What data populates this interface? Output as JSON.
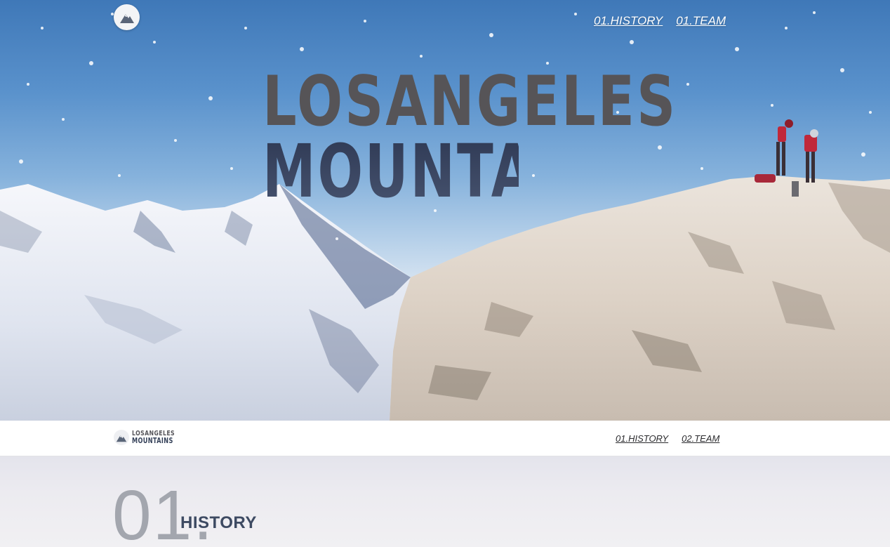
{
  "hero": {
    "logo_icon": "mountain-icon",
    "nav": [
      {
        "label": "01.HISTORY"
      },
      {
        "label": "01.TEAM"
      }
    ],
    "title_line1": "LOSANGELES",
    "title_line2": "MOUNTAINS"
  },
  "bar": {
    "logo_line1": "LOSANGELES",
    "logo_line2": "MOUNTAINS",
    "nav": [
      {
        "label": "01.HISTORY"
      },
      {
        "label": "02.TEAM"
      }
    ]
  },
  "section": {
    "number": "01.",
    "title": "HISTORY"
  },
  "colors": {
    "sky_top": "#3f78b8",
    "title_gray": "#565457",
    "title_navy": "#3c4a63",
    "section_bg": "#ecebf0"
  }
}
